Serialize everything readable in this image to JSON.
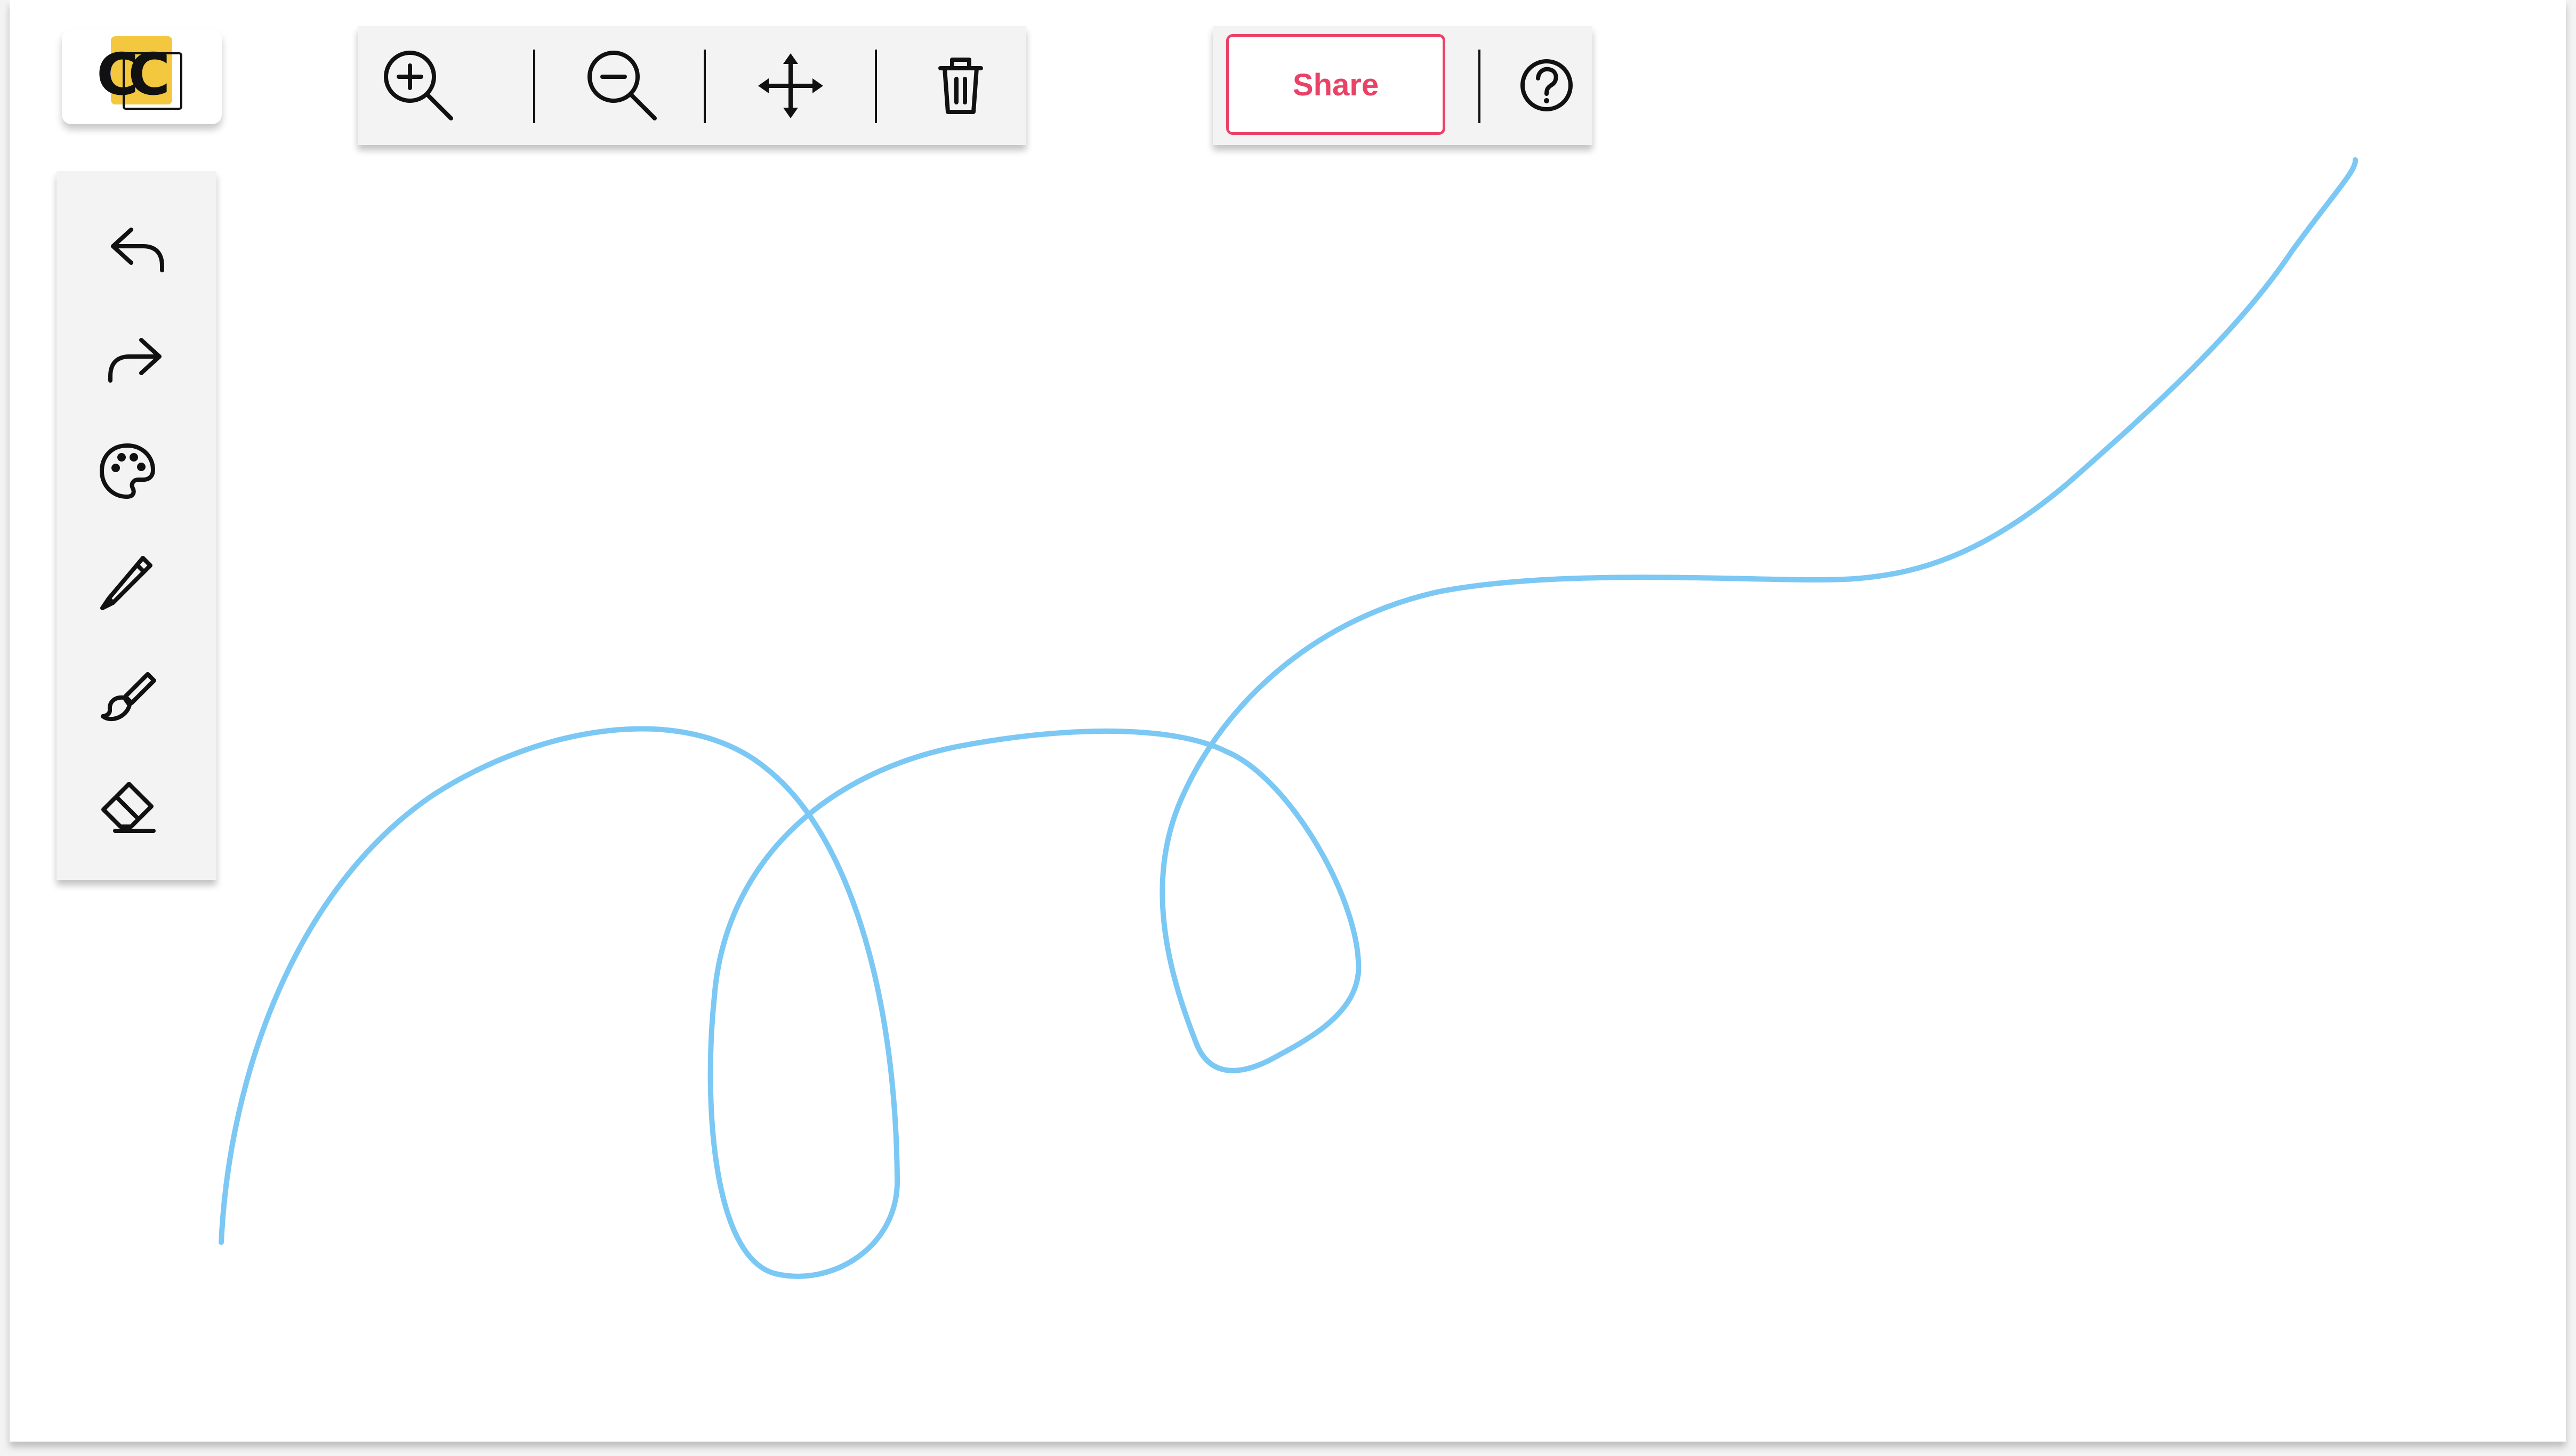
{
  "app": {
    "logo_text": "CC",
    "accent_color": "#e94267",
    "logo_color": "#f3c83f",
    "stroke_color": "#7cc8f4"
  },
  "top_toolbar": {
    "tools": [
      {
        "name": "zoom-in",
        "icon": "zoom-in-icon"
      },
      {
        "name": "zoom-out",
        "icon": "zoom-out-icon"
      },
      {
        "name": "pan",
        "icon": "move-icon"
      },
      {
        "name": "clear",
        "icon": "trash-icon"
      }
    ]
  },
  "left_toolbar": {
    "tools": [
      {
        "name": "undo",
        "icon": "undo-icon"
      },
      {
        "name": "redo",
        "icon": "redo-icon"
      },
      {
        "name": "color",
        "icon": "palette-icon"
      },
      {
        "name": "pencil",
        "icon": "pencil-icon"
      },
      {
        "name": "brush",
        "icon": "brush-icon"
      },
      {
        "name": "eraser",
        "icon": "eraser-icon"
      }
    ]
  },
  "share": {
    "label": "Share",
    "help_icon": "help-icon"
  }
}
